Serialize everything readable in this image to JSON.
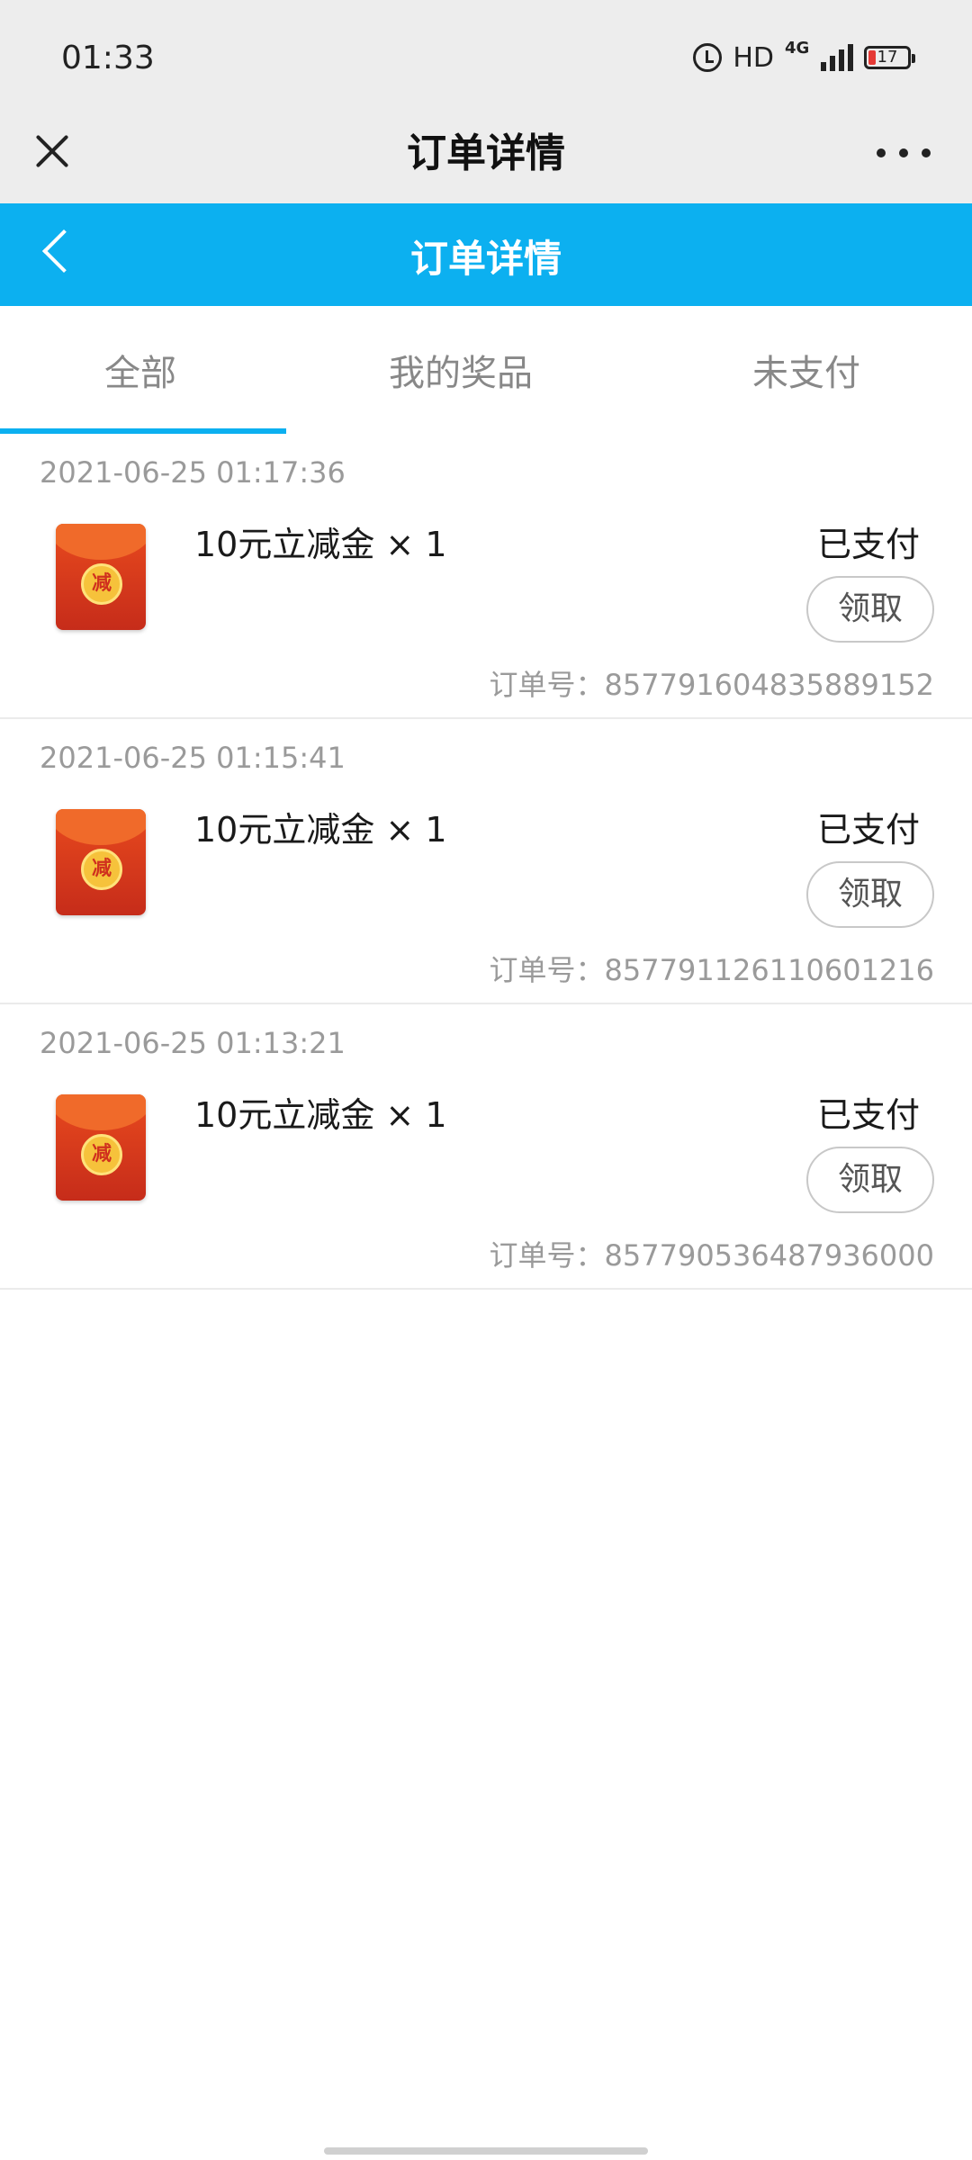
{
  "status_bar": {
    "time": "01:33",
    "hd": "HD",
    "network": "4G",
    "battery": "17"
  },
  "wx_bar": {
    "title": "订单详情"
  },
  "header": {
    "title": "订单详情"
  },
  "tabs": [
    {
      "label": "全部",
      "active": true
    },
    {
      "label": "我的奖品",
      "active": false
    },
    {
      "label": "未支付",
      "active": false
    }
  ],
  "orders": [
    {
      "time": "2021-06-25 01:17:36",
      "item": "10元立减金 × 1",
      "status": "已支付",
      "action": "领取",
      "order_no": "订单号：857791604835889152",
      "badge": "减"
    },
    {
      "time": "2021-06-25 01:15:41",
      "item": "10元立减金 × 1",
      "status": "已支付",
      "action": "领取",
      "order_no": "订单号：857791126110601216",
      "badge": "减"
    },
    {
      "time": "2021-06-25 01:13:21",
      "item": "10元立减金 × 1",
      "status": "已支付",
      "action": "领取",
      "order_no": "订单号：857790536487936000",
      "badge": "减"
    }
  ],
  "colors": {
    "accent": "#0cb0f0",
    "thumb_red": "#d0301e",
    "coin": "#f6c23b"
  }
}
